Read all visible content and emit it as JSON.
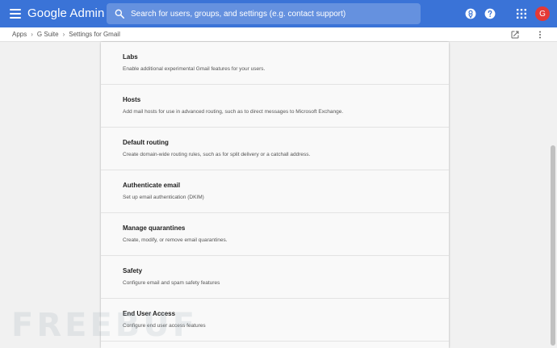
{
  "header": {
    "brand": "Google Admin",
    "search_placeholder": "Search for users, groups, and settings (e.g. contact support)",
    "avatar_initial": "G"
  },
  "breadcrumb": {
    "items": [
      "Apps",
      "G Suite",
      "Settings for Gmail"
    ]
  },
  "settings": [
    {
      "title": "Labs",
      "description": "Enable additional experimental Gmail features for your users."
    },
    {
      "title": "Hosts",
      "description": "Add mail hosts for use in advanced routing, such as to direct messages to Microsoft Exchange."
    },
    {
      "title": "Default routing",
      "description": "Create domain-wide routing rules, such as for split delivery or a catchall address."
    },
    {
      "title": "Authenticate email",
      "description": "Set up email authentication (DKIM)"
    },
    {
      "title": "Manage quarantines",
      "description": "Create, modify, or remove email quarantines."
    },
    {
      "title": "Safety",
      "description": "Configure email and spam safety features"
    },
    {
      "title": "End User Access",
      "description": "Configure end user access features"
    }
  ],
  "watermark": "FREEBUF",
  "icons": {
    "menu": "menu-icon",
    "search": "search-icon",
    "badge": "notification-badge-icon",
    "help": "help-icon",
    "apps": "apps-grid-icon",
    "open_new": "open-in-new-icon",
    "more": "more-vert-icon"
  },
  "colors": {
    "appbar": "#3a73d7",
    "avatar": "#e53935",
    "background": "#f1f1f1",
    "panel": "#f9f9f9"
  }
}
